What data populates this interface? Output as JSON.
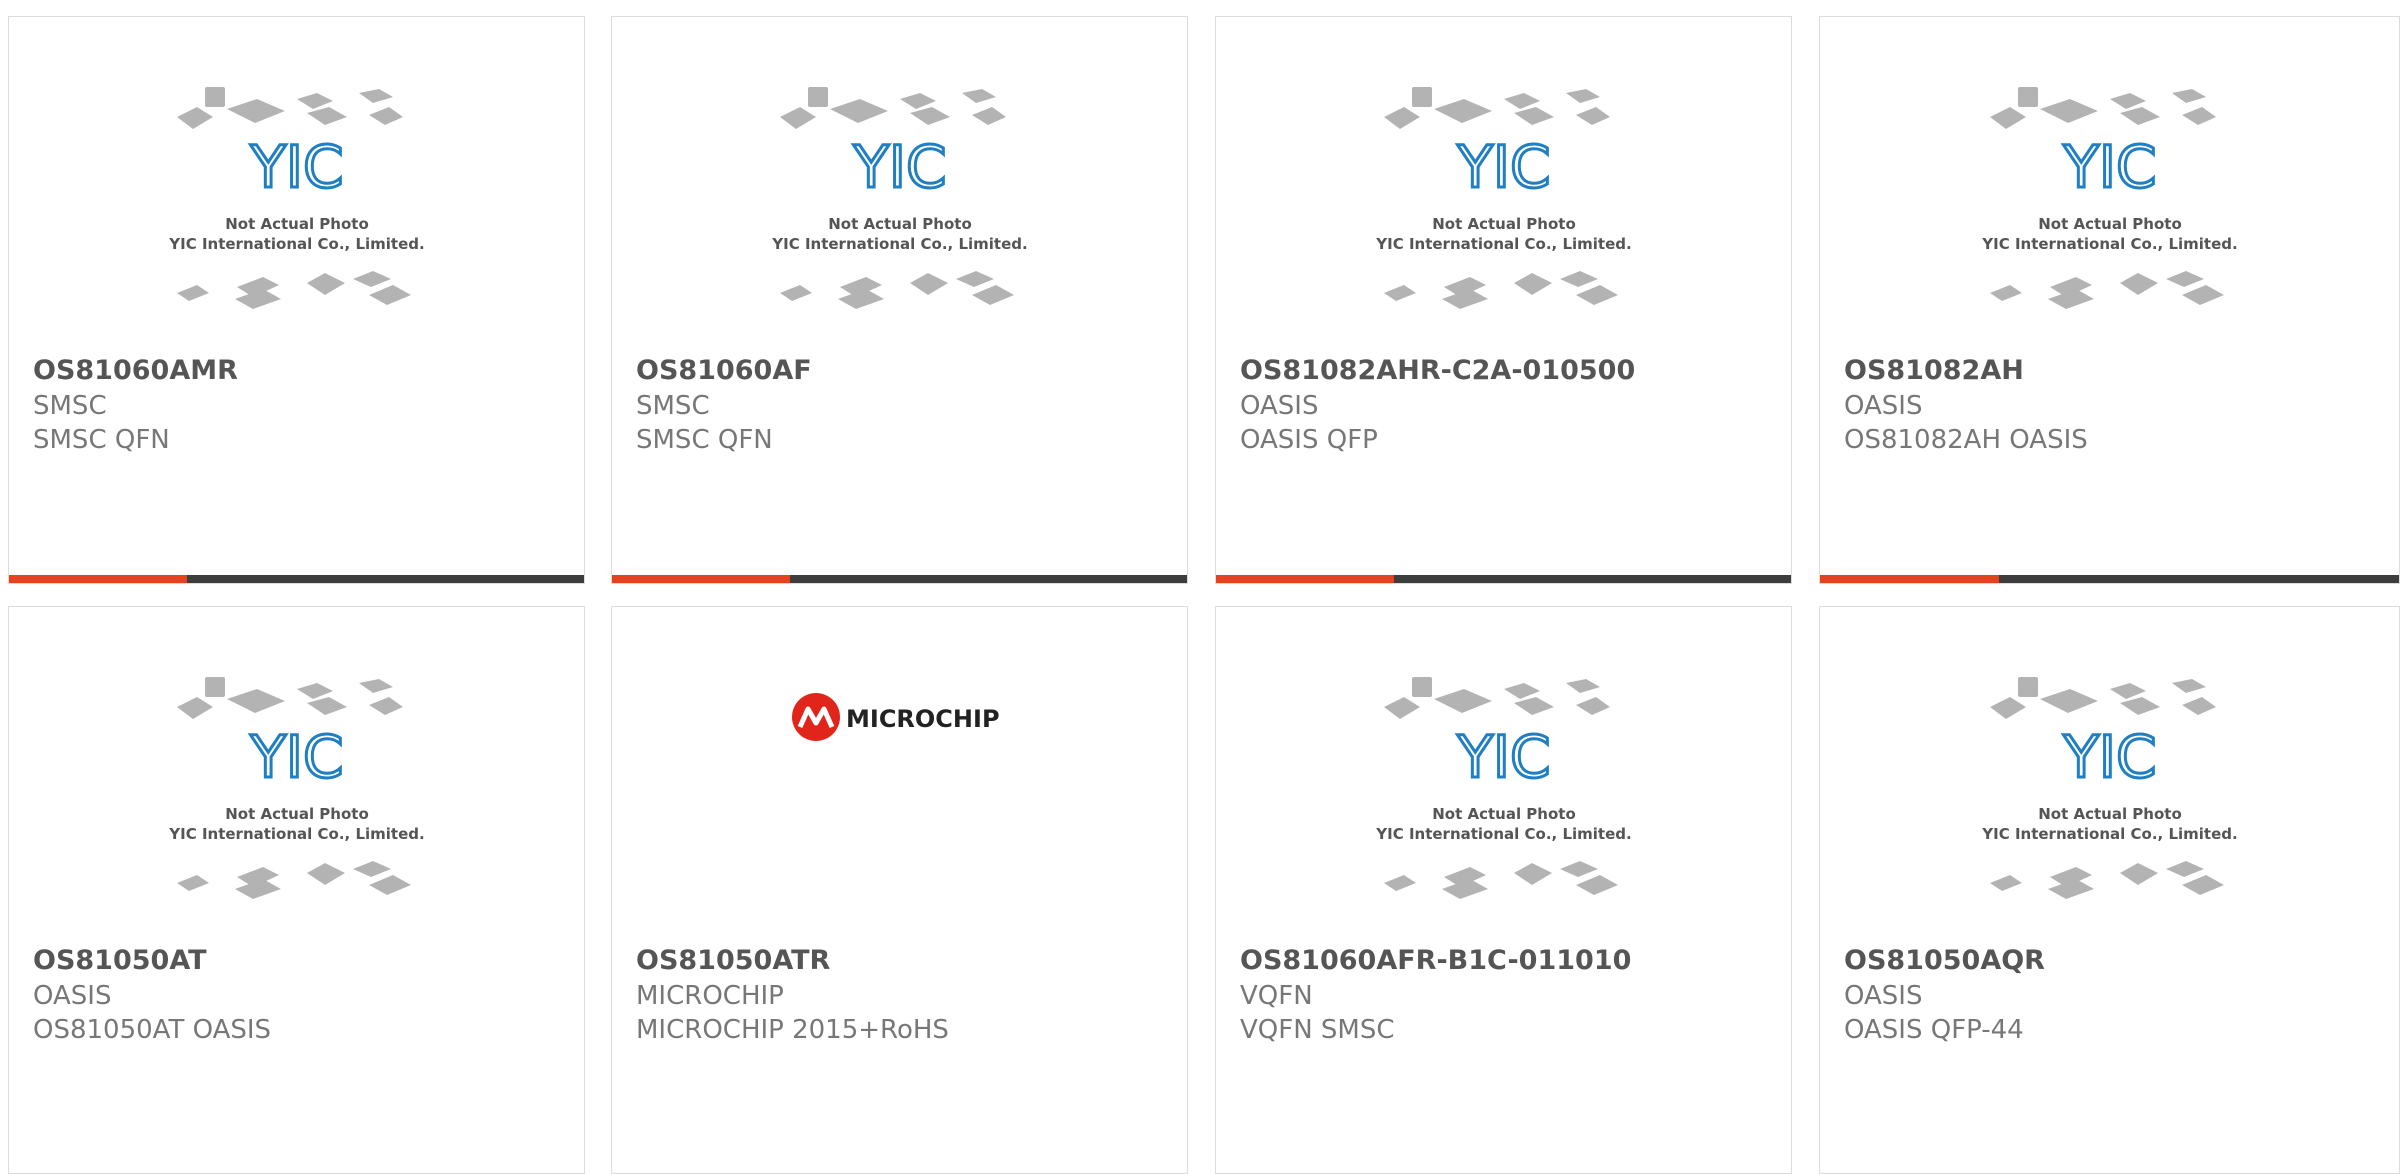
{
  "placeholder_photo": {
    "line1": "Not Actual Photo",
    "line2": "YIC International Co., Limited.",
    "logo_text": "YIC"
  },
  "colors": {
    "accent": "#e8411d",
    "bar": "#3d3d3d",
    "yic_blue": "#1f7fc2"
  },
  "cards": [
    {
      "part": "OS81060AMR",
      "manufacturer": "SMSC",
      "description": "SMSC QFN",
      "image": "placeholder",
      "progress": 0.31
    },
    {
      "part": "OS81060AF",
      "manufacturer": "SMSC",
      "description": "SMSC QFN",
      "image": "placeholder",
      "progress": 0.31
    },
    {
      "part": "OS81082AHR-C2A-010500",
      "manufacturer": "OASIS",
      "description": "OASIS QFP",
      "image": "placeholder",
      "progress": 0.31
    },
    {
      "part": "OS81082AH",
      "manufacturer": "OASIS",
      "description": "OS81082AH OASIS",
      "image": "placeholder",
      "progress": 0.31
    },
    {
      "part": "OS81050AT",
      "manufacturer": "OASIS",
      "description": "OS81050AT OASIS",
      "image": "placeholder"
    },
    {
      "part": "OS81050ATR",
      "manufacturer": "MICROCHIP",
      "description": "MICROCHIP 2015+RoHS",
      "image": "microchip-logo",
      "logo_text": "MICROCHIP"
    },
    {
      "part": "OS81060AFR-B1C-011010",
      "manufacturer": "VQFN",
      "description": "VQFN SMSC",
      "image": "placeholder"
    },
    {
      "part": "OS81050AQR",
      "manufacturer": "OASIS",
      "description": "OASIS QFP-44",
      "image": "placeholder"
    }
  ]
}
